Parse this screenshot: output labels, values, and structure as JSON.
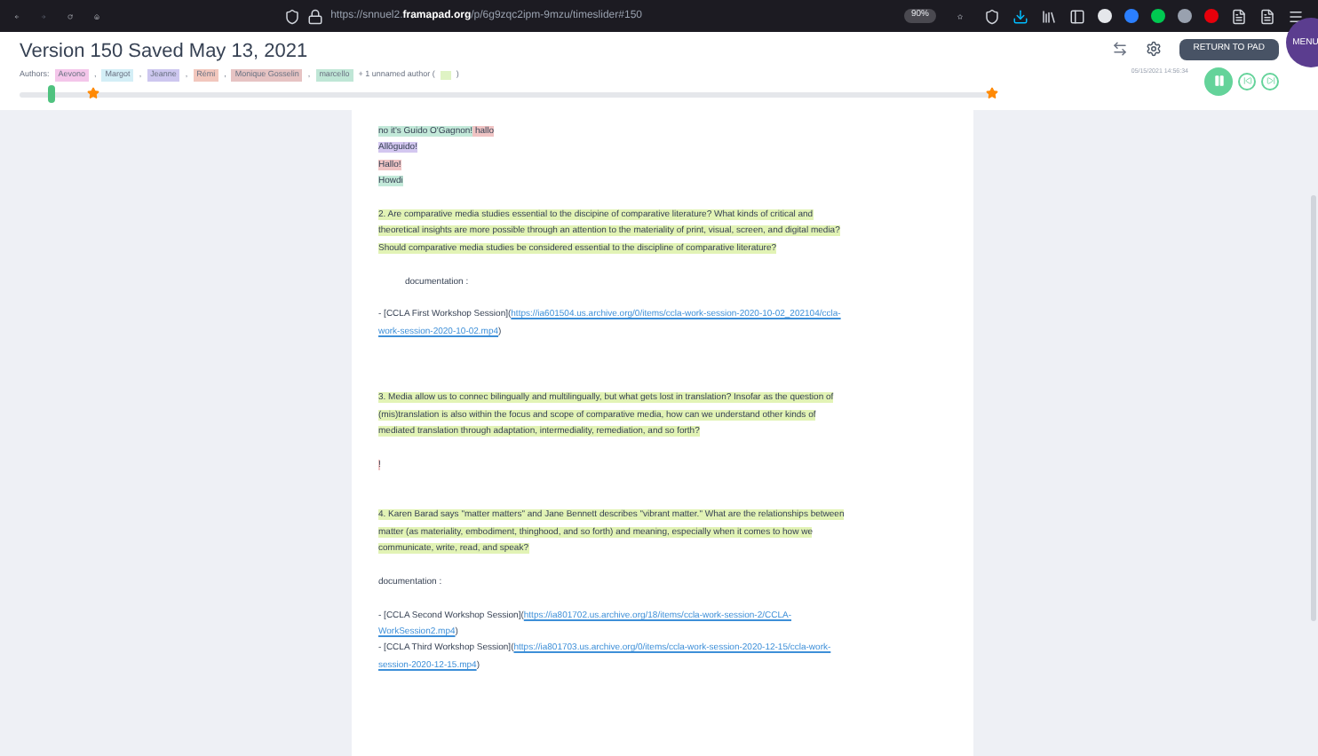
{
  "browser": {
    "url_prefix": "https://snnuel2.",
    "url_domain": "framapad.org",
    "url_rest": "/p/6g9zqc2ipm-9mzu/timeslider#150",
    "zoom": "90%"
  },
  "header": {
    "title": "Version 150 Saved May 13, 2021",
    "authors_label": "Authors:",
    "authors": [
      {
        "name": "Aevono",
        "color": "#f4c6ea"
      },
      {
        "name": "Margot",
        "color": "#d3eef6"
      },
      {
        "name": "Jeanne",
        "color": "#cdc7ef"
      },
      {
        "name": "Rémi",
        "color": "#f2c7bd"
      },
      {
        "name": "Monique Gosselin",
        "color": "#e6c3c3"
      },
      {
        "name": "marcello",
        "color": "#bfe6d6"
      }
    ],
    "separator": ",",
    "unnamed": {
      "text": "+ 1 unnamed author (",
      "close": ")",
      "color": "#dff3c4"
    },
    "return_button": "RETURN TO PAD",
    "timestamp": "05/15/2021 14:56:34",
    "menu_label": "MENU"
  },
  "slider": {
    "level": 0.03,
    "playing": true
  },
  "document": [
    {
      "kind": "text",
      "lines": [
        [
          {
            "text": "no it's Guido O'Gagnon!",
            "color": "#c3e9d9"
          },
          {
            "text": " hallo",
            "color": "#f0c4c4"
          }
        ]
      ]
    },
    {
      "kind": "text",
      "lines": [
        [
          {
            "text": "Allôguido!",
            "color": "#d3c7f0"
          }
        ]
      ]
    },
    {
      "kind": "text",
      "lines": [
        [
          {
            "text": "Hallo!",
            "color": "#f0c4c4"
          }
        ]
      ]
    },
    {
      "kind": "text",
      "lines": [
        [
          {
            "text": "Howdi",
            "color": "#c3e9d9"
          }
        ]
      ]
    },
    {
      "kind": "blank"
    },
    {
      "kind": "text",
      "lines": [
        [
          {
            "text": "2.  Are comparative media studies essential to the discipine of comparative literature? What kinds of critical and",
            "color": "#e2f3b5"
          }
        ],
        [
          {
            "text": "theoretical insights are more possible through an attention to the materiality of print, visual, screen, and digital media?",
            "color": "#e2f3b5"
          }
        ],
        [
          {
            "text": "Should comparative media studies be considered essential to the discipline of comparative literature?    ",
            "color": "#e2f3b5"
          }
        ]
      ]
    },
    {
      "kind": "blank"
    },
    {
      "kind": "indent",
      "lines": [
        [
          {
            "text": "documentation :"
          }
        ]
      ]
    },
    {
      "kind": "blank"
    },
    {
      "kind": "text",
      "lines": [
        [
          {
            "text": "- [CCLA First Workshop Session]("
          },
          {
            "text": "https://ia601504.us.archive.org/0/items/ccla-work-session-2020-10-02_202104/ccla-",
            "link": true
          }
        ],
        [
          {
            "text": "work-session-2020-10-02.mp4",
            "link": true
          },
          {
            "text": ")"
          }
        ]
      ]
    },
    {
      "kind": "blank"
    },
    {
      "kind": "blank"
    },
    {
      "kind": "blank"
    },
    {
      "kind": "text",
      "lines": [
        [
          {
            "text": "3. Media allow us to connec bilingually and multilingually, but what gets lost in translation? Insofar as the question of",
            "color": "#e2f3b5"
          }
        ],
        [
          {
            "text": "(mis)translation is also within the focus and scope of comparative media, how can we understand other kinds of",
            "color": "#e2f3b5"
          }
        ],
        [
          {
            "text": "mediated translation through adaptation, intermediality, remediation, and so forth?",
            "color": "#e2f3b5"
          }
        ]
      ]
    },
    {
      "kind": "blank"
    },
    {
      "kind": "text",
      "lines": [
        [
          {
            "text": "!",
            "color": "#f0c4c4"
          }
        ]
      ]
    },
    {
      "kind": "blank"
    },
    {
      "kind": "blank"
    },
    {
      "kind": "text",
      "lines": [
        [
          {
            "text": "4. Karen Barad says \"matter matters\" and Jane Bennett describes \"vibrant matter.\" What are the relationships between",
            "color": "#e2f3b5"
          }
        ],
        [
          {
            "text": "matter (as materiality, embodiment, thinghood, and so forth) and meaning, especially when it comes to how we",
            "color": "#e2f3b5"
          }
        ],
        [
          {
            "text": "communicate, write, read, and speak?",
            "color": "#e2f3b5"
          }
        ]
      ]
    },
    {
      "kind": "blank"
    },
    {
      "kind": "text",
      "lines": [
        [
          {
            "text": "documentation :"
          }
        ]
      ]
    },
    {
      "kind": "blank"
    },
    {
      "kind": "text",
      "lines": [
        [
          {
            "text": "- [CCLA Second Workshop Session]("
          },
          {
            "text": "https://ia801702.us.archive.org/18/items/ccla-work-session-2/CCLA-",
            "link": true
          }
        ],
        [
          {
            "text": "WorkSession2.mp4",
            "link": true
          },
          {
            "text": ")"
          }
        ]
      ]
    },
    {
      "kind": "text",
      "lines": [
        [
          {
            "text": "- [CCLA Third Workshop Session]("
          },
          {
            "text": "https://ia801703.us.archive.org/0/items/ccla-work-session-2020-12-15/ccla-work-",
            "link": true
          }
        ],
        [
          {
            "text": "session-2020-12-15.mp4",
            "link": true
          },
          {
            "text": ")"
          }
        ]
      ]
    }
  ]
}
